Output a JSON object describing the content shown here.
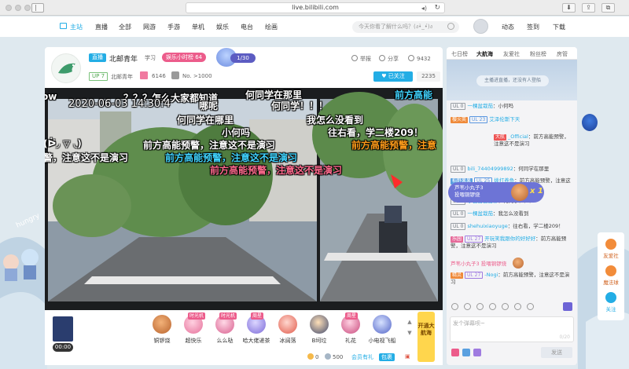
{
  "browser": {
    "url": "live.bilibili.com"
  },
  "nav": {
    "items": [
      "主站",
      "直播",
      "全部",
      "网游",
      "手游",
      "单机",
      "娱乐",
      "电台",
      "绘画"
    ],
    "search_placeholder": "今天你看了解什么吗？(ง•̀_•́)ง",
    "right_items": [
      "动态",
      "签到",
      "下载"
    ]
  },
  "header": {
    "live_tag": "直播",
    "room_title": "北邮青年",
    "room_tag": "学习",
    "rank_label": "娱乐小时榜 64",
    "rank_count": "1/30",
    "up_badge": "UP 7",
    "up_name": "北邮青年",
    "gift_count": "6146",
    "level_text": "No. >1000",
    "tools": [
      "举报",
      "分享",
      "9432"
    ],
    "follow_label": "已关注",
    "follow_count": "2235"
  },
  "video": {
    "danmaku": [
      {
        "text": "ow",
        "color": "white"
      },
      {
        "text": "？？？怎么大家都知道",
        "color": "white"
      },
      {
        "text": "何同学在那里",
        "color": "white"
      },
      {
        "text": "前方高能",
        "color": "cyan"
      },
      {
        "text": "2020-06-03 14:30:4",
        "color": "white"
      },
      {
        "text": "哪呢",
        "color": "white"
      },
      {
        "text": "何同学！！！",
        "color": "white"
      },
      {
        "text": "何同学在哪里",
        "color": "white"
      },
      {
        "text": "我怎么没看到",
        "color": "white"
      },
      {
        "text": "小何吗",
        "color": "white"
      },
      {
        "text": "往右看，学二楼209！",
        "color": "white"
      },
      {
        "text": "(ᐖ◞ ▽ ◟)",
        "color": "white"
      },
      {
        "text": "前方高能预警，注意这不是演习",
        "color": "white"
      },
      {
        "text": "前方高能预警，注意",
        "color": "orange"
      },
      {
        "text": "警，注意这不是演习",
        "color": "white"
      },
      {
        "text": "前方高能预警，注意这不是演习",
        "color": "cyan"
      },
      {
        "text": "前方高能预警，注意这不是演习",
        "color": "pink"
      }
    ]
  },
  "giftbar": {
    "timer": "00:00",
    "gifts": [
      {
        "name": "铜锣烧",
        "tag": ""
      },
      {
        "name": "超快乐",
        "tag": "时光机"
      },
      {
        "name": "么么哒",
        "tag": "时光机"
      },
      {
        "name": "哈大佬递茶",
        "tag": "周星"
      },
      {
        "name": "冰阔落",
        "tag": ""
      },
      {
        "name": "B坷垃",
        "tag": ""
      },
      {
        "name": "礼花",
        "tag": "周星"
      },
      {
        "name": "小电视飞船",
        "tag": ""
      }
    ],
    "promo": "开通大航海",
    "wallet": {
      "gold": "0",
      "silver": "500",
      "store": "会员有礼",
      "pack": "包裹"
    }
  },
  "chat": {
    "tabs": [
      "七日榜",
      "大航海",
      "友爱社",
      "粉丝榜",
      "房管"
    ],
    "banner_text": "主播进直播，还没有人登船",
    "messages": [
      {
        "ul": "UL 0",
        "ul_style": "gray",
        "medal": "",
        "name": "一棵盆栽茄",
        "text": "：小何吗"
      },
      {
        "ul": "UL 23",
        "ul_style": "blue",
        "medal": "樱火英",
        "name": "艾泽伦斯下天",
        "text": ""
      },
      {
        "ul": "",
        "ul_style": "",
        "medal": "大航",
        "name": "_Official",
        "text": "：前方高能预警，注意这不是演习"
      },
      {
        "ul": "UL 0",
        "ul_style": "gray",
        "medal": "",
        "name": "bili_74404999892",
        "text": "：何同学在那里"
      },
      {
        "ul": "UL 25",
        "ul_style": "blue",
        "medal": "稻野果果",
        "name": "拨打养鱼",
        "text": "：前方高能预警，注意这不是演习"
      },
      {
        "ul": "UL 0",
        "ul_style": "gray",
        "medal": "",
        "name": "小白白白白亦",
        "text": "：何同学！！！"
      },
      {
        "ul": "UL 0",
        "ul_style": "gray",
        "medal": "",
        "name": "一棵盆栽茄",
        "text": "：我怎么没看到"
      },
      {
        "ul": "UL 0",
        "ul_style": "gray",
        "medal": "",
        "name": "shehuixiaoyuge",
        "text": "：往右看，学二楼209！"
      },
      {
        "ul": "UL 27",
        "ul_style": "purple",
        "medal": "乐园",
        "name": "开玩笑我跟你的好好好",
        "text": "：前方高能预警，注意这不是演习"
      },
      {
        "ul": "",
        "ul_style": "",
        "medal": "",
        "name": "芦苇小丸子3",
        "text": " 投喂铜锣烧"
      },
      {
        "ul": "UL 27",
        "ul_style": "purple",
        "medal": "精灵",
        "name": "-Nogi",
        "text": "：前方高能预警，注意这不是演习"
      }
    ],
    "gift_popup": {
      "user": "芦苇小丸子3",
      "action": "投喂铜锣烧",
      "multiplier": "x 1"
    },
    "input_placeholder": "发个弹幕呗~",
    "input_count": "0/20",
    "send_label": "发送"
  },
  "side_buttons": [
    "友爱社",
    "魔法球",
    "关注"
  ]
}
